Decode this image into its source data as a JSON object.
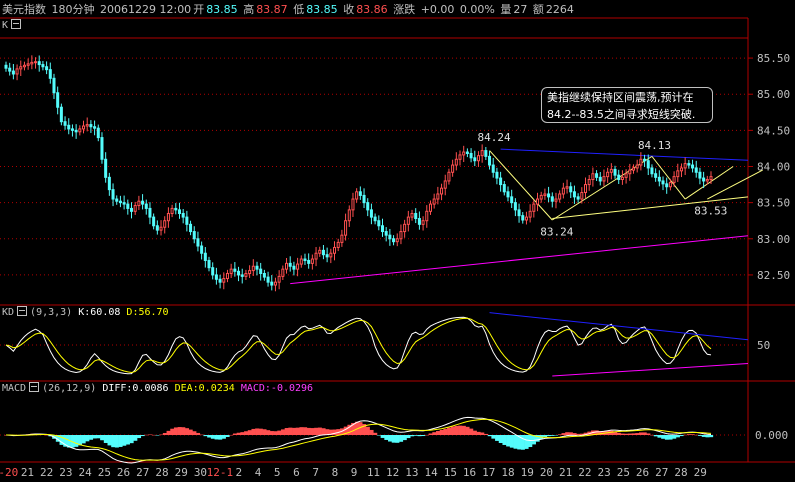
{
  "header": {
    "title": "美元指数",
    "period": "180分钟",
    "datetime": "20061229 12:00",
    "open_label": "开",
    "open": "83.85",
    "high_label": "高",
    "high": "83.87",
    "low_label": "低",
    "low": "83.85",
    "close_label": "收",
    "close": "83.86",
    "change_label": "涨跌",
    "change": "+0.00",
    "change_pct": "0.00%",
    "volume_label": "量",
    "volume": "27",
    "amount_label": "额",
    "amount": "2264"
  },
  "kline_panel": {
    "label": "K"
  },
  "kd_panel": {
    "label": "KD",
    "params": "(9,3,3)",
    "k_text": "K:60.08",
    "d_text": "D:56.70",
    "level_label": "50"
  },
  "macd_panel": {
    "label": "MACD",
    "params": "(26,12,9)",
    "diff_text": "DIFF:0.0086",
    "dea_text": "DEA:0.0234",
    "macd_text": "MACD:-0.0296",
    "zero_label": "0.000"
  },
  "annotation": {
    "line1": "美指继续保持区间震荡,预计在",
    "line2": "84.2--83.5之间寻求短线突破."
  },
  "price_labels": {
    "high_a": "84.24",
    "low_a": "83.24",
    "high_b": "84.13",
    "low_b": "83.53"
  },
  "colors": {
    "up": "#ff5050",
    "down": "#54fcfc",
    "k_line": "#ffffff",
    "d_line": "#ffff00",
    "grid": "#b00000",
    "trend_blue": "#2020ff",
    "trend_magenta": "#ff00ff",
    "trend_yellow": "#ffff80",
    "axis_text": "#c0c0c0"
  },
  "chart_data": [
    {
      "type": "candlestick",
      "title": "美元指数",
      "y_ticks": [
        "82.50",
        "83.00",
        "83.50",
        "84.00",
        "84.50",
        "85.00",
        "85.50"
      ],
      "ylim": [
        82.1,
        85.75
      ],
      "x_tick_labels": [
        "-20",
        "21",
        "22",
        "23",
        "24",
        "25",
        "26",
        "27",
        "28",
        "29",
        "30",
        "12-1",
        "2",
        "4",
        "5",
        "6",
        "7",
        "8",
        "9",
        "11",
        "12",
        "13",
        "14",
        "15",
        "16",
        "17",
        "18",
        "19",
        "20",
        "21",
        "22",
        "23",
        "25",
        "26",
        "27",
        "28",
        "29"
      ],
      "closes": [
        85.36,
        85.32,
        85.28,
        85.35,
        85.38,
        85.4,
        85.42,
        85.44,
        85.45,
        85.41,
        85.38,
        85.34,
        85.22,
        85.02,
        84.82,
        84.62,
        84.57,
        84.52,
        84.5,
        84.48,
        84.52,
        84.56,
        84.58,
        84.55,
        84.53,
        84.4,
        84.1,
        83.85,
        83.68,
        83.55,
        83.52,
        83.5,
        83.48,
        83.42,
        83.38,
        83.46,
        83.52,
        83.48,
        83.42,
        83.3,
        83.18,
        83.12,
        83.16,
        83.25,
        83.35,
        83.42,
        83.4,
        83.35,
        83.3,
        83.2,
        83.1,
        83.0,
        82.9,
        82.8,
        82.7,
        82.6,
        82.5,
        82.44,
        82.4,
        82.45,
        82.52,
        82.58,
        82.55,
        82.5,
        82.48,
        82.52,
        82.56,
        82.62,
        82.58,
        82.52,
        82.47,
        82.4,
        82.36,
        82.4,
        82.48,
        82.58,
        82.66,
        82.62,
        82.58,
        82.65,
        82.72,
        82.7,
        82.66,
        82.72,
        82.8,
        82.84,
        82.78,
        82.75,
        82.8,
        82.88,
        82.95,
        83.05,
        83.25,
        83.4,
        83.55,
        83.65,
        83.6,
        83.5,
        83.4,
        83.3,
        83.25,
        83.18,
        83.1,
        83.05,
        83.0,
        82.96,
        83.0,
        83.1,
        83.2,
        83.3,
        83.35,
        83.28,
        83.2,
        83.25,
        83.38,
        83.48,
        83.55,
        83.62,
        83.7,
        83.8,
        83.92,
        84.02,
        84.1,
        84.16,
        84.2,
        84.18,
        84.12,
        84.08,
        84.15,
        84.22,
        84.14,
        84.02,
        83.92,
        83.84,
        83.75,
        83.65,
        83.58,
        83.5,
        83.4,
        83.32,
        83.26,
        83.3,
        83.38,
        83.48,
        83.55,
        83.6,
        83.62,
        83.58,
        83.52,
        83.55,
        83.62,
        83.7,
        83.72,
        83.65,
        83.58,
        83.55,
        83.64,
        83.75,
        83.82,
        83.9,
        83.85,
        83.8,
        83.86,
        83.92,
        83.96,
        83.88,
        83.82,
        83.85,
        83.9,
        83.95,
        83.98,
        84.02,
        84.1,
        84.08,
        83.98,
        83.9,
        83.85,
        83.8,
        83.76,
        83.72,
        83.78,
        83.86,
        83.94,
        83.98,
        84.04,
        84.02,
        83.98,
        83.92,
        83.84,
        83.8,
        83.82,
        83.86
      ],
      "trendlines": [
        {
          "from": [
            134,
            84.24
          ],
          "to": [
            208,
            84.07
          ]
        },
        {
          "from": [
            77,
            82.38
          ],
          "to": [
            208,
            83.08
          ]
        },
        {
          "from": [
            148,
            83.28
          ],
          "to": [
            208,
            83.62
          ]
        }
      ]
    },
    {
      "type": "line",
      "title": "KD",
      "series": [
        {
          "name": "K"
        },
        {
          "name": "D"
        }
      ],
      "ylim": [
        0,
        100
      ],
      "k_last": 60.08,
      "d_last": 56.7
    },
    {
      "type": "bar",
      "title": "MACD",
      "series": [
        {
          "name": "DIFF"
        },
        {
          "name": "DEA"
        },
        {
          "name": "MACD"
        }
      ],
      "diff_last": 0.0086,
      "dea_last": 0.0234,
      "macd_last": -0.0296
    }
  ]
}
